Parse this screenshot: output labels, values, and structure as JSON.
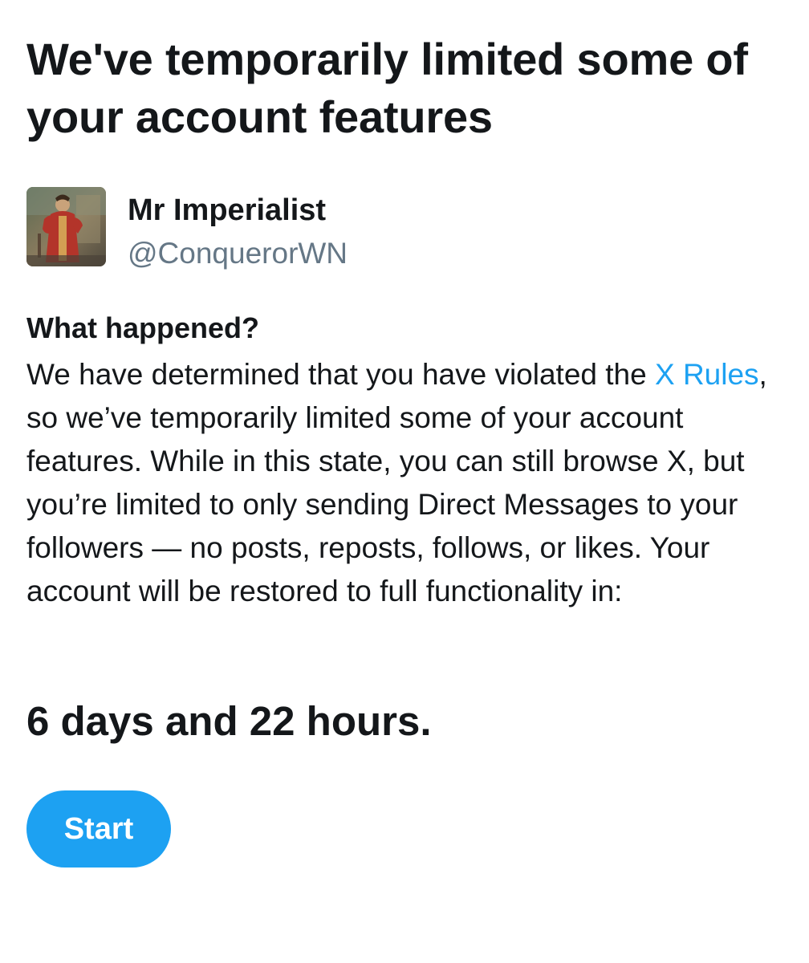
{
  "page": {
    "title": "We've temporarily limited some of your account features"
  },
  "account": {
    "display_name": "Mr Imperialist",
    "handle": "@ConquerorWN",
    "avatar_icon": "avatar-image"
  },
  "notice": {
    "heading": "What happened?",
    "body_before_link": "We have determined that you have violated the ",
    "link_text": "X Rules",
    "body_after_link": ", so we’ve temporarily limited some of your account features. While in this state, you can still browse X, but you’re limited to only sending Direct Messages to your followers — no posts, reposts, follows, or likes. Your account will be restored to full functionality in:",
    "countdown": "6 days and 22 hours."
  },
  "actions": {
    "start_label": "Start"
  },
  "colors": {
    "accent": "#1da1f2",
    "text_primary": "#14171a",
    "text_secondary": "#657786",
    "background": "#ffffff"
  }
}
